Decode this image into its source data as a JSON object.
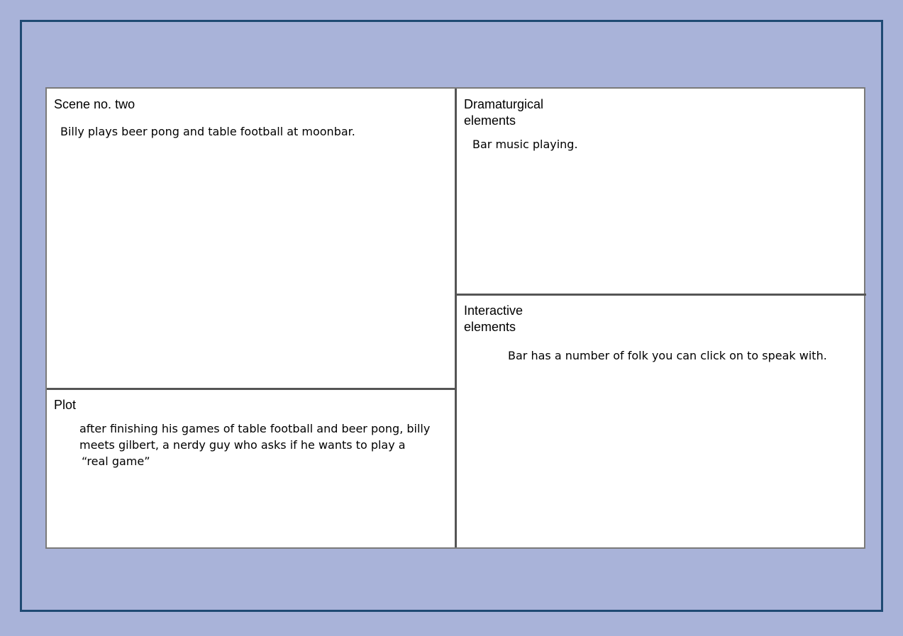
{
  "scene": {
    "heading": "Scene no. two",
    "text": "Billy plays beer pong and table football at moonbar."
  },
  "plot": {
    "heading": "Plot",
    "lines": [
      "after finishing his games of table football and beer pong, billy",
      "meets gilbert, a nerdy guy who asks if he wants to play a",
      "“real game”"
    ]
  },
  "dramaturgical": {
    "heading_lines": [
      "Dramaturgical",
      "elements"
    ],
    "text": "Bar music playing."
  },
  "interactive": {
    "heading_lines": [
      "Interactive",
      "elements"
    ],
    "text": "Bar has a number of folk you can click on to speak with."
  },
  "colors": {
    "background": "#a9b3d9",
    "frame": "#1f4a73",
    "panel": "#ffffff",
    "divider": "#555555"
  }
}
